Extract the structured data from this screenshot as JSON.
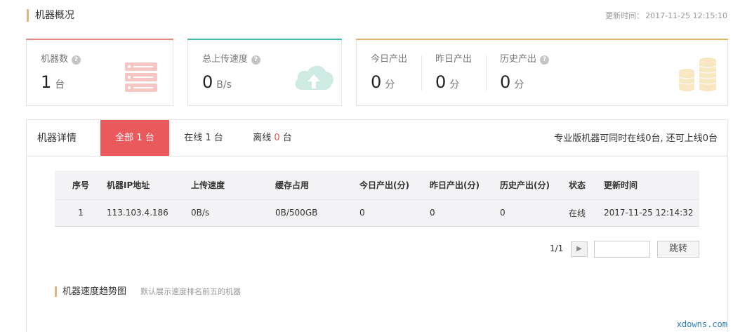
{
  "header": {
    "title": "机器概况",
    "updated_label": "更新时间：",
    "updated_time": "2017-11-25 12:15:10"
  },
  "cards": {
    "machines": {
      "label": "机器数",
      "value": "1",
      "unit": "台",
      "icon": "server-icon",
      "color": "#f6c6c4"
    },
    "upload": {
      "label": "总上传速度",
      "value": "0",
      "unit": "B/s",
      "icon": "cloud-upload-icon",
      "color": "#cfe9e3"
    },
    "today": {
      "label": "今日产出",
      "value": "0",
      "unit": "分"
    },
    "yesterday": {
      "label": "昨日产出",
      "value": "0",
      "unit": "分"
    },
    "history": {
      "label": "历史产出",
      "value": "0",
      "unit": "分",
      "icon": "coins-icon",
      "color": "#f7e7c2"
    },
    "help_icon": "help-icon"
  },
  "details": {
    "title": "机器详情",
    "tabs": [
      {
        "label": "全部",
        "count": "1",
        "unit": "台",
        "active": true
      },
      {
        "label": "在线",
        "count": "1",
        "unit": "台",
        "active": false
      },
      {
        "label": "离线",
        "count": "0",
        "unit": "台",
        "active": false
      }
    ],
    "note": "专业版机器可同时在线0台, 还可上线0台",
    "table": {
      "columns": [
        "序号",
        "机器IP地址",
        "上传速度",
        "缓存占用",
        "今日产出(分)",
        "昨日产出(分)",
        "历史产出(分)",
        "状态",
        "更新时间"
      ],
      "rows": [
        [
          "1",
          "113.103.4.186",
          "0B/s",
          "0B/500GB",
          "0",
          "0",
          "0",
          "在线",
          "2017-11-25 12:14:32"
        ]
      ]
    },
    "pager": {
      "pages": "1/1",
      "next_icon": "arrow-right-icon",
      "jump_input_value": "",
      "jump_label": "跳转"
    }
  },
  "trend": {
    "title": "机器速度趋势图",
    "subtitle": "默认展示速度排名前五的机器"
  },
  "watermark": "xdowns.com",
  "colors": {
    "accent_tab": "#ea5a5c",
    "card1_line": "#e98580",
    "card2_line": "#46b7ad",
    "card3_line": "#e0b865",
    "section_bar": "#d8b783"
  }
}
